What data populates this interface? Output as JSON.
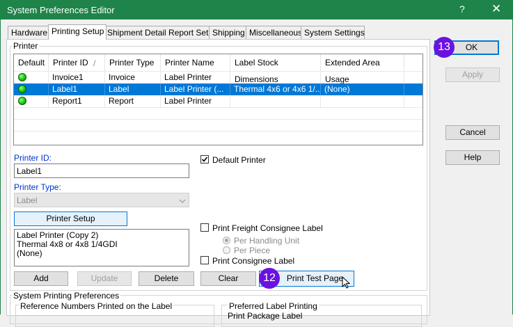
{
  "window": {
    "title": "System Preferences Editor",
    "help_glyph": "?",
    "close_glyph": "✕"
  },
  "tabs": [
    "Hardware",
    "Printing Setup",
    "Shipment Detail Report Setup",
    "Shipping",
    "Miscellaneous",
    "System Settings"
  ],
  "printer_group": {
    "label": "Printer"
  },
  "grid": {
    "headers": [
      "Default",
      "Printer ID",
      "/",
      "Printer Type",
      "Printer Name",
      "Label Stock Dimensions",
      "Extended Area Usage"
    ],
    "rows": [
      {
        "id": "Invoice1",
        "type": "Invoice",
        "name": "Label  Printer",
        "dims": "",
        "ext": ""
      },
      {
        "id": "Label1",
        "type": "Label",
        "name": "Label  Printer   (...",
        "dims": "Thermal 4x6 or 4x6 1/...",
        "ext": "(None)"
      },
      {
        "id": "Report1",
        "type": "Report",
        "name": "Label  Printer",
        "dims": "",
        "ext": ""
      }
    ]
  },
  "fields": {
    "printer_id_label": "Printer ID:",
    "printer_id_value": "Label1",
    "printer_type_label": "Printer Type:",
    "printer_type_value": "Label",
    "default_printer_label": "Default Printer",
    "printer_setup_button": "Printer Setup",
    "info_line1": "Label Printer  (Copy 2)",
    "info_line2": "Thermal 4x8 or 4x8 1/4GDI",
    "info_line3": "(None)",
    "freight_consignee_label": "Print Freight Consignee Label",
    "per_handling_unit": "Per Handling Unit",
    "per_piece": "Per Piece",
    "consignee_label": "Print Consignee Label"
  },
  "buttons": {
    "add": "Add",
    "update": "Update",
    "delete": "Delete",
    "clear": "Clear",
    "print_test": "Print Test Page",
    "ok": "OK",
    "apply": "Apply",
    "cancel": "Cancel",
    "help": "Help"
  },
  "system_printing": {
    "label": "System Printing Preferences",
    "ref_label": "Reference Numbers Printed on the Label",
    "preferred_label": "Preferred Label Printing",
    "cut_text": "Print Package Label"
  },
  "badges": {
    "ok_badge": "13",
    "print_badge": "12"
  },
  "colors": {
    "titlebar": "#1e8449",
    "selection": "#0078d7",
    "badge": "#6a13e0"
  }
}
